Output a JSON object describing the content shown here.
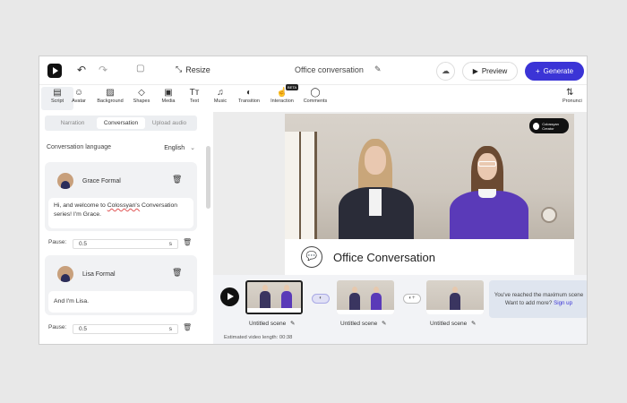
{
  "topbar": {
    "resize_label": "Resize",
    "project_title": "Office conversation",
    "preview_label": "Preview",
    "generate_label": "Generate",
    "accent": "#3b34d6"
  },
  "toolbar": {
    "items": [
      {
        "label": "Script",
        "icon": "script-icon"
      },
      {
        "label": "Avatar",
        "icon": "avatar-icon"
      },
      {
        "label": "Background",
        "icon": "background-icon"
      },
      {
        "label": "Shapes",
        "icon": "shapes-icon"
      },
      {
        "label": "Media",
        "icon": "media-icon"
      },
      {
        "label": "Text",
        "icon": "text-icon"
      },
      {
        "label": "Music",
        "icon": "music-icon"
      },
      {
        "label": "Transition",
        "icon": "transition-icon"
      },
      {
        "label": "Interaction",
        "icon": "interaction-icon",
        "badge": "BETA"
      },
      {
        "label": "Comments",
        "icon": "comments-icon"
      }
    ],
    "right_label": "Pronunci"
  },
  "left_panel": {
    "tabs": [
      "Narration",
      "Conversation",
      "Upload audio"
    ],
    "active_tab": "Conversation",
    "conversation_language_label": "Conversation language",
    "language_value": "English",
    "speakers": [
      {
        "name": "Grace Formal",
        "message_pre": "Hi, and welcome to ",
        "message_misspelled": "Colossyan's",
        "message_post": " Conversation series! I'm Grace.",
        "pause_label": "Pause:",
        "pause_value": "0.5",
        "pause_unit": "s"
      },
      {
        "name": "Lisa Formal",
        "message": "And I'm Lisa.",
        "pause_label": "Pause:",
        "pause_value": "0.5",
        "pause_unit": "s"
      }
    ]
  },
  "canvas": {
    "brand_label": "Colossyan Creator",
    "lower_third_title": "Office Conversation"
  },
  "timeline": {
    "scenes": [
      {
        "name": "Untitled scene",
        "selected": true
      },
      {
        "name": "Untitled scene",
        "selected": false
      },
      {
        "name": "Untitled scene",
        "selected": false
      }
    ],
    "max_scenes_text": "You've reached the maximum scene",
    "want_more_text": "Want to add more?",
    "sign_up_label": "Sign up",
    "estimated_label": "Estimated video length: 00:38"
  }
}
